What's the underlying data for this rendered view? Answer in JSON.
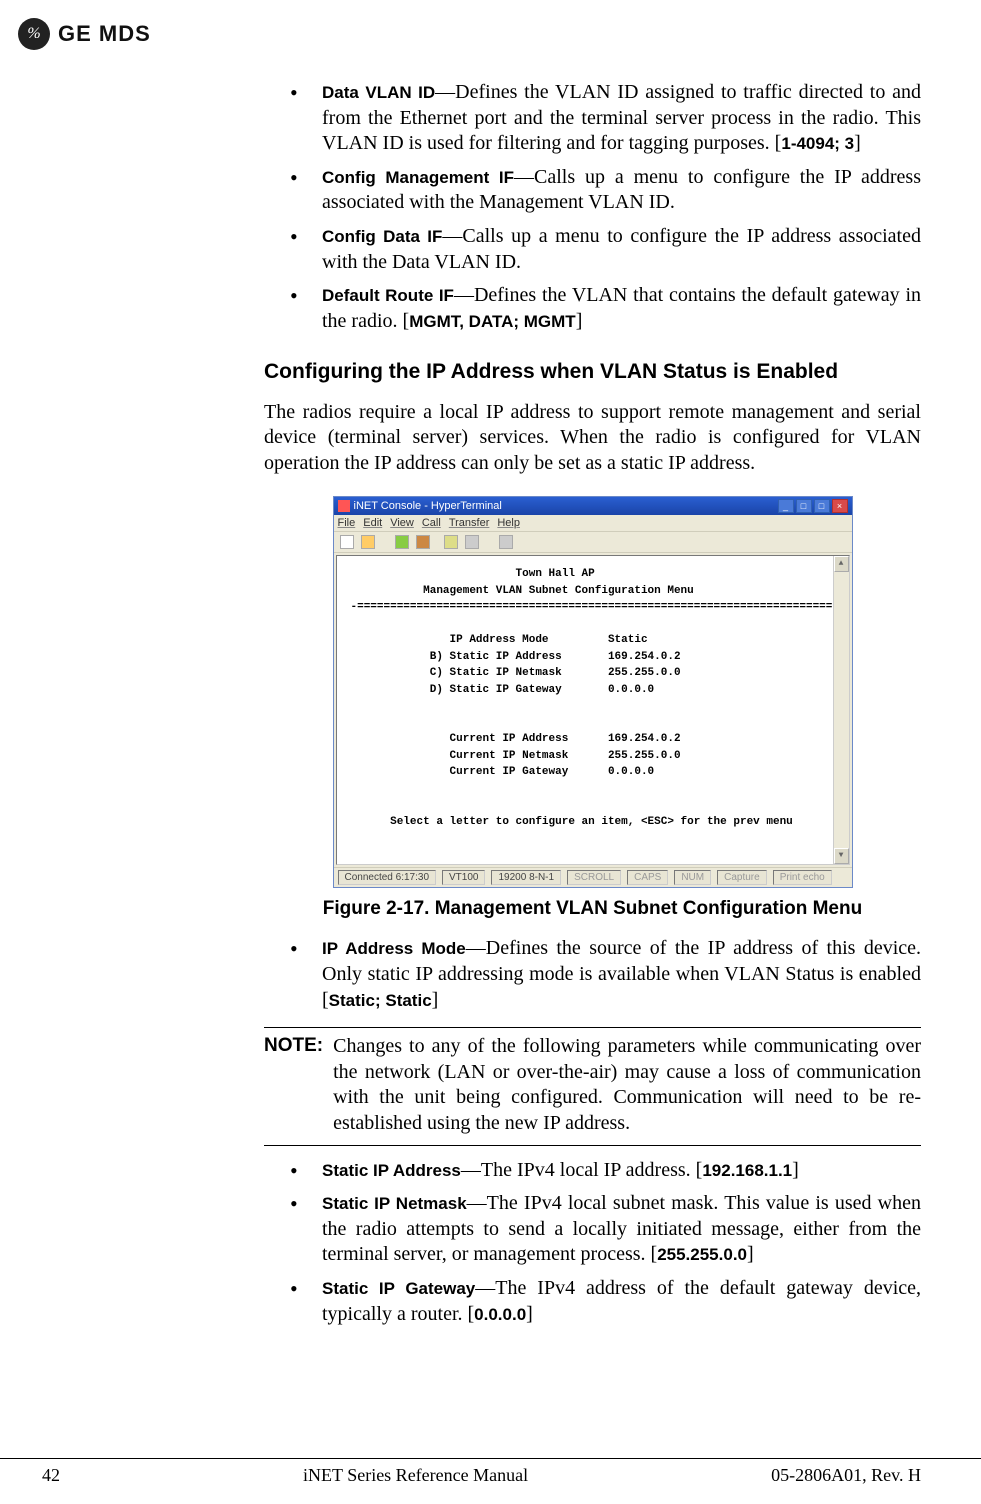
{
  "logo": {
    "brand1": "GE",
    "brand2": "MDS",
    "monogram": "%"
  },
  "bullets_top": [
    {
      "term": "Data VLAN ID",
      "desc": "—Defines the VLAN ID assigned to traffic directed to and from the Ethernet port and the terminal server process in the radio. This VLAN ID is used for filtering and for tagging purposes. [",
      "range": "1-4094; 3",
      "after": "]"
    },
    {
      "term": "Config Management IF",
      "desc": "—Calls up a menu to configure the IP address associated with the Management VLAN ID."
    },
    {
      "term": "Config Data IF",
      "desc": "—Calls up a menu to configure the IP address associated with the Data VLAN ID."
    },
    {
      "term": "Default Route IF",
      "desc": "—Defines the VLAN that contains the default gateway in the radio. [",
      "range": "MGMT, DATA; MGMT",
      "after": "]"
    }
  ],
  "heading1": "Configuring the IP Address when VLAN Status is Enabled",
  "para1": "The radios require a local IP address to support remote management and serial device (terminal server) services. When the radio is configured for VLAN operation the IP address can only be set as a static IP address.",
  "screenshot": {
    "title": "iNET Console - HyperTerminal",
    "menus": [
      "File",
      "Edit",
      "View",
      "Call",
      "Transfer",
      "Help"
    ],
    "term_title1": "Town Hall AP",
    "term_title2": "Management VLAN Subnet Configuration Menu",
    "divider": "-========================================================================-",
    "rows": [
      {
        "label": "   IP Address Mode",
        "value": "Static"
      },
      {
        "label": "B) Static IP Address",
        "value": "169.254.0.2"
      },
      {
        "label": "C) Static IP Netmask",
        "value": "255.255.0.0"
      },
      {
        "label": "D) Static IP Gateway",
        "value": "0.0.0.0"
      }
    ],
    "rows2": [
      {
        "label": "   Current IP Address",
        "value": "169.254.0.2"
      },
      {
        "label": "   Current IP Netmask",
        "value": "255.255.0.0"
      },
      {
        "label": "   Current IP Gateway",
        "value": "0.0.0.0"
      }
    ],
    "footer_line": "Select a letter to configure an item, <ESC> for the prev menu",
    "status": {
      "conn": "Connected 6:17:30",
      "term": "VT100",
      "baud": "19200 8-N-1",
      "scroll": "SCROLL",
      "caps": "CAPS",
      "num": "NUM",
      "capture": "Capture",
      "print": "Print echo"
    }
  },
  "figure_caption": "Figure 2-17. Management VLAN Subnet Configuration Menu",
  "bullets_mid": [
    {
      "term": "IP Address Mode",
      "desc": "—Defines the source of the IP address of this device. Only static IP addressing mode is available when VLAN Status is enabled [",
      "range": "Static; Static",
      "after": "]"
    }
  ],
  "note": {
    "label": "NOTE:",
    "text": "Changes to any of the following parameters while communicating over the network (LAN or over-the-air) may cause a loss of communication with the unit being configured. Communication will need to be re-established using the new IP address."
  },
  "bullets_bottom": [
    {
      "term": "Static IP Address",
      "desc": "—The IPv4 local IP address. [",
      "range": "192.168.1.1",
      "after": "]"
    },
    {
      "term": "Static IP Netmask",
      "desc": "—The IPv4 local subnet mask. This value is used when the radio attempts to send a locally initiated message, either from the terminal server, or management process. [",
      "range": "255.255.0.0",
      "after": "]"
    },
    {
      "term": "Static IP Gateway",
      "desc": "—The IPv4 address of the default gateway device, typically a router. [",
      "range": "0.0.0.0",
      "after": "]"
    }
  ],
  "footer": {
    "page": "42",
    "center": "iNET Series Reference Manual",
    "right": "05-2806A01, Rev. H"
  }
}
